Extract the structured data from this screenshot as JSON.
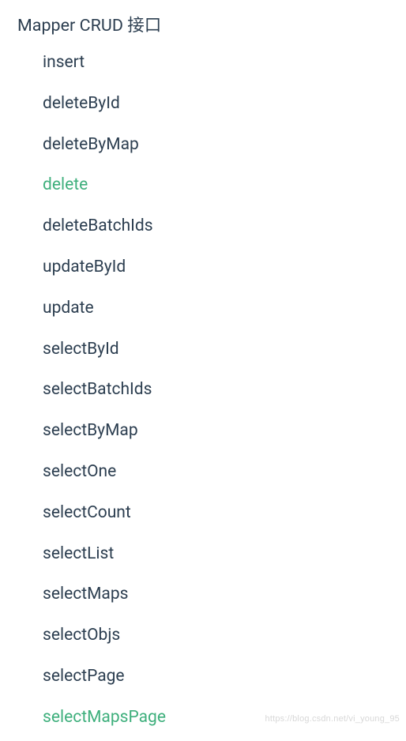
{
  "heading": "Mapper CRUD 接口",
  "items": [
    "insert",
    "deleteById",
    "deleteByMap",
    "delete",
    "deleteBatchIds",
    "updateById",
    "update",
    "selectById",
    "selectBatchIds",
    "selectByMap",
    "selectOne",
    "selectCount",
    "selectList",
    "selectMaps",
    "selectObjs",
    "selectPage",
    "selectMapsPage"
  ],
  "activeIndices": [
    3,
    16
  ],
  "watermark": "https://blog.csdn.net/vi_young_95"
}
